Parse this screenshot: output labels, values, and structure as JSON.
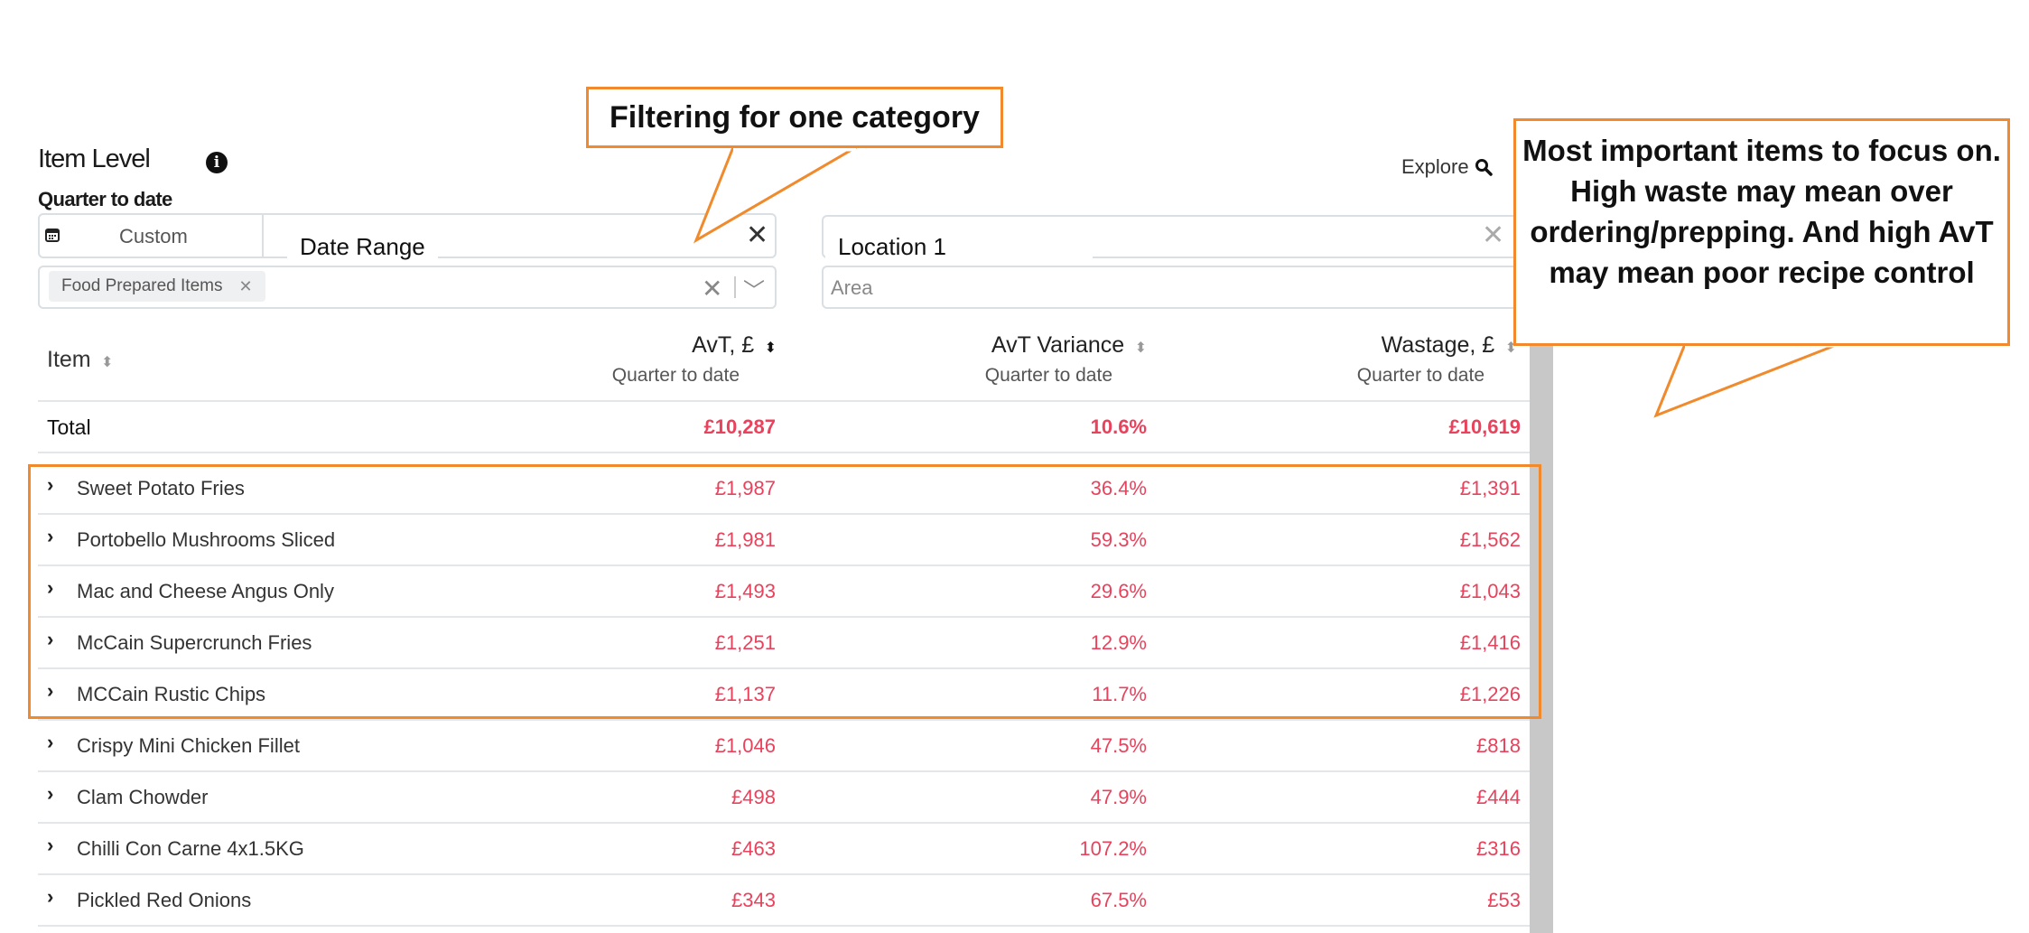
{
  "header": {
    "title": "Item Level",
    "period": "Quarter to date",
    "explore_label": "Explore"
  },
  "filters": {
    "date_preset": "Custom",
    "date_range_label": "Date Range",
    "category_chip": "Food Prepared Items",
    "location_label": "Location 1",
    "area_placeholder": "Area"
  },
  "table": {
    "columns": [
      {
        "label": "Item"
      },
      {
        "label": "AvT, £",
        "sub": "Quarter to date"
      },
      {
        "label": "AvT Variance",
        "sub": "Quarter to date"
      },
      {
        "label": "Wastage, £",
        "sub": "Quarter to date"
      }
    ],
    "total": {
      "label": "Total",
      "avt": "£10,287",
      "variance": "10.6%",
      "wastage": "£10,619"
    },
    "rows": [
      {
        "name": "Sweet Potato Fries",
        "avt": "£1,987",
        "variance": "36.4%",
        "wastage": "£1,391"
      },
      {
        "name": "Portobello Mushrooms Sliced",
        "avt": "£1,981",
        "variance": "59.3%",
        "wastage": "£1,562"
      },
      {
        "name": "Mac and Cheese Angus Only",
        "avt": "£1,493",
        "variance": "29.6%",
        "wastage": "£1,043"
      },
      {
        "name": "McCain Supercrunch Fries",
        "avt": "£1,251",
        "variance": "12.9%",
        "wastage": "£1,416"
      },
      {
        "name": "MCCain Rustic Chips",
        "avt": "£1,137",
        "variance": "11.7%",
        "wastage": "£1,226"
      },
      {
        "name": "Crispy Mini Chicken Fillet",
        "avt": "£1,046",
        "variance": "47.5%",
        "wastage": "£818"
      },
      {
        "name": "Clam Chowder",
        "avt": "£498",
        "variance": "47.9%",
        "wastage": "£444"
      },
      {
        "name": "Chilli Con Carne 4x1.5KG",
        "avt": "£463",
        "variance": "107.2%",
        "wastage": "£316"
      },
      {
        "name": "Pickled Red Onions",
        "avt": "£343",
        "variance": "67.5%",
        "wastage": "£53"
      }
    ]
  },
  "annotations": {
    "filter_note": "Filtering for one category",
    "focus_note": "Most important items to focus on. High waste may mean over ordering/prepping. And high AvT may mean poor recipe control"
  },
  "colors": {
    "accent_orange": "#f08a2c",
    "value_red": "#e8425c"
  }
}
